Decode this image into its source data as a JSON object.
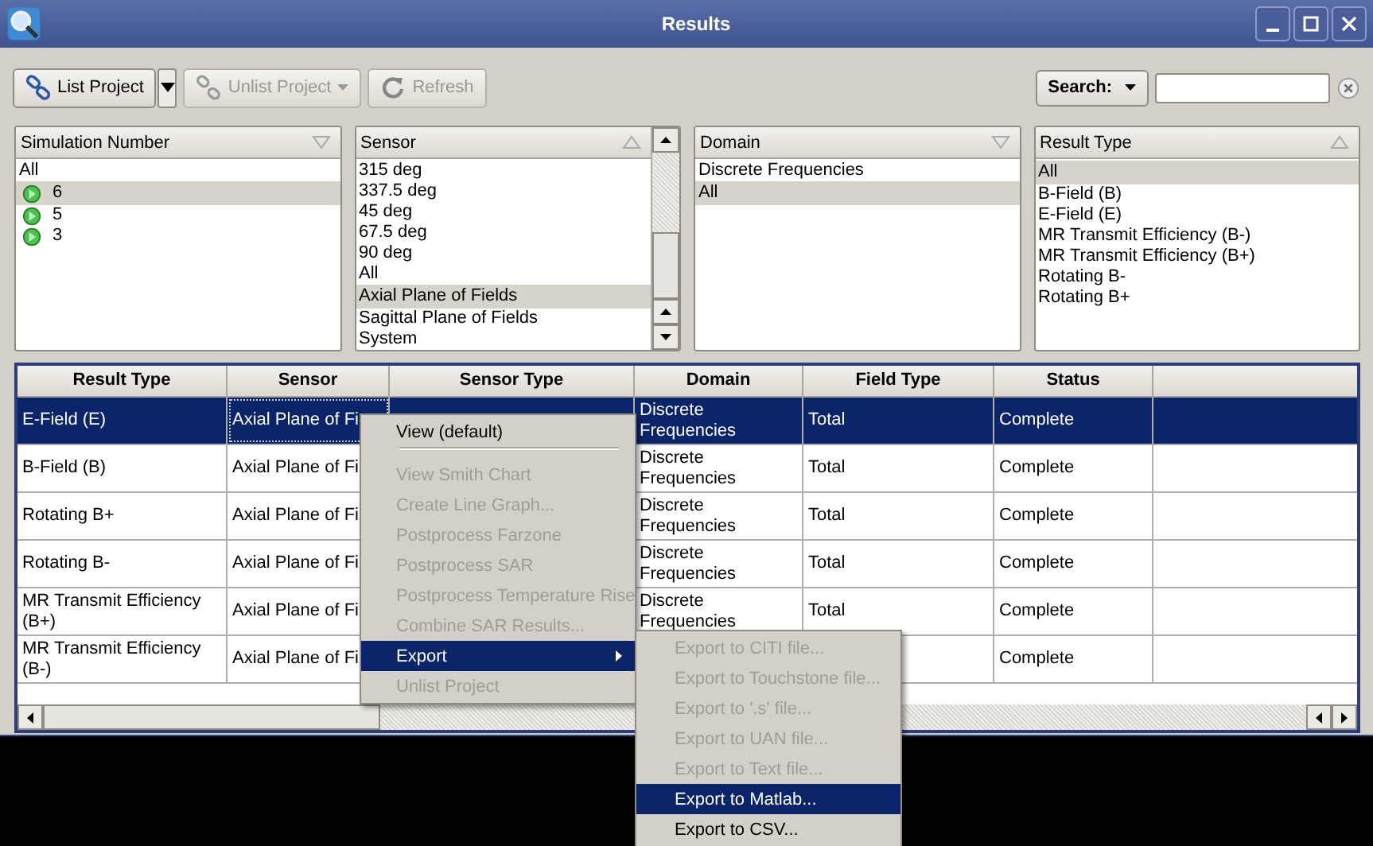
{
  "window": {
    "title": "Results"
  },
  "toolbar": [
    {
      "label": "List Project",
      "kind": "link",
      "disabled": false,
      "split_dropdown": true,
      "caret": false
    },
    {
      "label": "Unlist Project",
      "kind": "unlink",
      "disabled": true,
      "split_dropdown": false,
      "caret": true
    },
    {
      "label": "Refresh",
      "kind": "refresh",
      "disabled": true,
      "split_dropdown": false,
      "caret": false
    }
  ],
  "search": {
    "label": "Search:"
  },
  "filters": [
    {
      "header": "Simulation Number",
      "sort_ascending": false,
      "scrollable": false,
      "items": [
        {
          "label": "All",
          "selected": false,
          "kind": "plain"
        },
        {
          "label": "6",
          "selected": true,
          "kind": "simulation"
        },
        {
          "label": "5",
          "selected": false,
          "kind": "simulation"
        },
        {
          "label": "3",
          "selected": false,
          "kind": "simulation"
        }
      ]
    },
    {
      "header": "Sensor",
      "sort_ascending": true,
      "scrollable": true,
      "items": [
        {
          "label": "315 deg",
          "selected": false,
          "kind": "plain"
        },
        {
          "label": "337.5 deg",
          "selected": false,
          "kind": "plain"
        },
        {
          "label": "45 deg",
          "selected": false,
          "kind": "plain"
        },
        {
          "label": "67.5 deg",
          "selected": false,
          "kind": "plain"
        },
        {
          "label": "90 deg",
          "selected": false,
          "kind": "plain"
        },
        {
          "label": "All",
          "selected": false,
          "kind": "plain"
        },
        {
          "label": "Axial Plane of Fields",
          "selected": true,
          "kind": "plain"
        },
        {
          "label": "Sagittal Plane of Fields",
          "selected": false,
          "kind": "plain"
        },
        {
          "label": "System",
          "selected": false,
          "kind": "plain"
        }
      ]
    },
    {
      "header": "Domain",
      "sort_ascending": false,
      "scrollable": false,
      "items": [
        {
          "label": "Discrete Frequencies",
          "selected": false,
          "kind": "plain"
        },
        {
          "label": "All",
          "selected": true,
          "kind": "plain"
        }
      ]
    },
    {
      "header": "Result Type",
      "sort_ascending": true,
      "scrollable": false,
      "items": [
        {
          "label": "All",
          "selected": true,
          "kind": "plain"
        },
        {
          "label": "B-Field (B)",
          "selected": false,
          "kind": "plain"
        },
        {
          "label": "E-Field (E)",
          "selected": false,
          "kind": "plain"
        },
        {
          "label": "MR Transmit Efficiency (B-)",
          "selected": false,
          "kind": "plain"
        },
        {
          "label": "MR Transmit Efficiency (B+)",
          "selected": false,
          "kind": "plain"
        },
        {
          "label": "Rotating B-",
          "selected": false,
          "kind": "plain"
        },
        {
          "label": "Rotating B+",
          "selected": false,
          "kind": "plain"
        }
      ]
    }
  ],
  "table": {
    "columns": [
      "Result Type",
      "Sensor",
      "Sensor Type",
      "Domain",
      "Field Type",
      "Status"
    ],
    "rows": [
      {
        "selected": true,
        "cells": [
          "E-Field (E)",
          "Axial Plane of Fi",
          null,
          "Discrete Frequencies",
          "Total",
          "Complete"
        ]
      },
      {
        "selected": false,
        "cells": [
          "B-Field (B)",
          "Axial Plane of Fi",
          null,
          "Discrete Frequencies",
          "Total",
          "Complete"
        ]
      },
      {
        "selected": false,
        "cells": [
          "Rotating B+",
          "Axial Plane of Fi",
          null,
          "Discrete Frequencies",
          "Total",
          "Complete"
        ]
      },
      {
        "selected": false,
        "cells": [
          "Rotating B-",
          "Axial Plane of Fi",
          null,
          "Discrete Frequencies",
          "Total",
          "Complete"
        ]
      },
      {
        "selected": false,
        "cells": [
          "MR Transmit Efficiency (B+)",
          "Axial Plane of Fi",
          null,
          "Discrete Frequencies",
          "Total",
          "Complete"
        ]
      },
      {
        "selected": false,
        "cells": [
          "MR Transmit Efficiency (B-)",
          "Axial Plane of Fi",
          null,
          null,
          null,
          "Complete"
        ]
      }
    ]
  },
  "context_menu": {
    "items": [
      {
        "label": "View (default)",
        "disabled": false,
        "selected": false,
        "submenu": false,
        "separator_after": true
      },
      {
        "label": "View Smith Chart",
        "disabled": true,
        "selected": false,
        "submenu": false,
        "separator_after": false
      },
      {
        "label": "Create Line Graph...",
        "disabled": true,
        "selected": false,
        "submenu": false,
        "separator_after": false
      },
      {
        "label": "Postprocess Farzone",
        "disabled": true,
        "selected": false,
        "submenu": false,
        "separator_after": false
      },
      {
        "label": "Postprocess SAR",
        "disabled": true,
        "selected": false,
        "submenu": false,
        "separator_after": false
      },
      {
        "label": "Postprocess Temperature Rise",
        "disabled": true,
        "selected": false,
        "submenu": false,
        "separator_after": false
      },
      {
        "label": "Combine SAR Results...",
        "disabled": true,
        "selected": false,
        "submenu": false,
        "separator_after": false
      },
      {
        "label": "Export",
        "disabled": false,
        "selected": true,
        "submenu": true,
        "separator_after": false
      },
      {
        "label": "Unlist Project",
        "disabled": true,
        "selected": false,
        "submenu": false,
        "separator_after": false
      }
    ]
  },
  "submenu": {
    "items": [
      {
        "label": "Export to CITI file...",
        "disabled": true,
        "selected": false
      },
      {
        "label": "Export to Touchstone file...",
        "disabled": true,
        "selected": false
      },
      {
        "label": "Export to '.s' file...",
        "disabled": true,
        "selected": false
      },
      {
        "label": "Export to UAN file...",
        "disabled": true,
        "selected": false
      },
      {
        "label": "Export to Text file...",
        "disabled": true,
        "selected": false
      },
      {
        "label": "Export to Matlab...",
        "disabled": false,
        "selected": true
      },
      {
        "label": "Export to CSV...",
        "disabled": false,
        "selected": false
      }
    ]
  }
}
